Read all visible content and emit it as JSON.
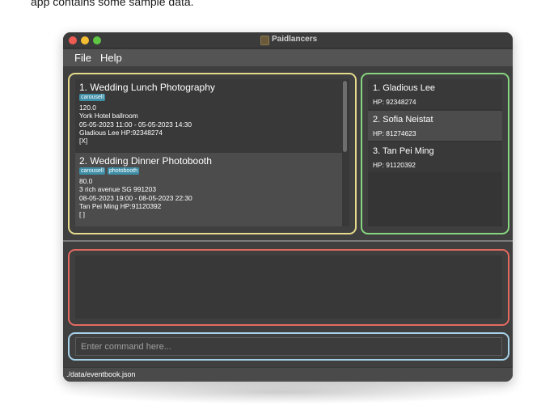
{
  "caption": "app contains some sample data.",
  "window": {
    "title": "Paidlancers"
  },
  "menu": {
    "file": "File",
    "help": "Help"
  },
  "events": [
    {
      "title": "1.  Wedding Lunch Photography",
      "tags": [
        "carousell"
      ],
      "rate": "120.0",
      "address": "York Hotel ballroom",
      "timing": "05-05-2023 11:00 - 05-05-2023 14:30",
      "contact": "Gladious Lee HP:92348274",
      "mark": "[X]"
    },
    {
      "title": "2.  Wedding Dinner Photobooth",
      "tags": [
        "carousell",
        "photobooth"
      ],
      "rate": "80.0",
      "address": "3 rich avenue SG 991203",
      "timing": "08-05-2023 19:00 - 08-05-2023 22:30",
      "contact": "Tan Pei Ming HP:91120392",
      "mark": "[ ]"
    }
  ],
  "contacts": [
    {
      "name": "1. Gladious Lee",
      "phone": "HP: 92348274"
    },
    {
      "name": "2. Sofia Neistat",
      "phone": "HP: 81274623"
    },
    {
      "name": "3. Tan Pei Ming",
      "phone": "HP: 91120392"
    }
  ],
  "result": {
    "text": ""
  },
  "command": {
    "placeholder": "Enter command here...",
    "value": ""
  },
  "status": {
    "path": "./data/eventbook.json"
  },
  "colors": {
    "events_border": "#e6da8c",
    "contacts_border": "#86d67f",
    "result_border": "#e46a60",
    "command_border": "#a5d2e8",
    "tag_bg": "#3f8ea7"
  }
}
